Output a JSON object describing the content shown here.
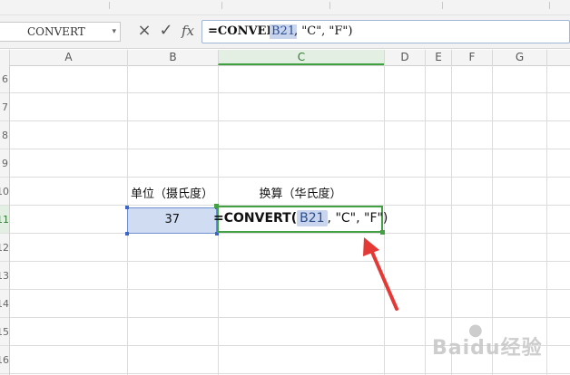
{
  "formula_bar": {
    "name_box": "CONVERT",
    "cancel_icon": "×",
    "enter_icon": "✓",
    "fx_label": "fx",
    "formula_prefix": "=CONVERT(",
    "formula_ref": "B21",
    "formula_suffix": ", \"C\", \"F\")"
  },
  "columns": [
    "A",
    "B",
    "C",
    "D",
    "E",
    "F",
    "G"
  ],
  "active_column": "C",
  "rows": [
    "6",
    "7",
    "8",
    "9",
    "10",
    "11",
    "12",
    "13",
    "14",
    "15",
    "16"
  ],
  "active_row": "11",
  "cells": {
    "b10": "单位（摄氏度）",
    "c10": "换算（华氏度）",
    "b11": "37",
    "c11_prefix": "=CONVERT(",
    "c11_ref": "B21",
    "c11_suffix": ", \"C\", \"F\")"
  },
  "watermark": {
    "text": "Baidu经验"
  },
  "colors": {
    "selection_green": "#43a043",
    "reference_blue": "#c9d5ec",
    "arrow_red": "#e53935"
  },
  "icons": {
    "name_box_dropdown": "chevron-down-icon",
    "cancel": "close-icon",
    "enter": "check-icon",
    "insert_function": "fx-icon"
  }
}
